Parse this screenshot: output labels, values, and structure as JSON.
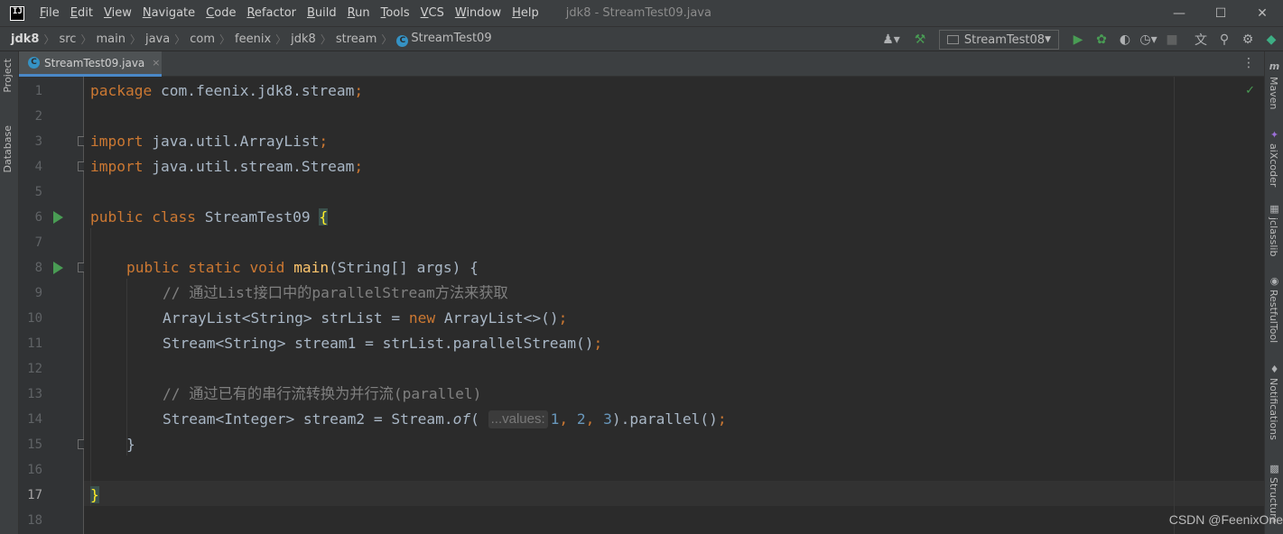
{
  "window": {
    "title": "jdk8 - StreamTest09.java",
    "logo": "IJ",
    "minimize_icon": "—",
    "maximize_icon": "☐",
    "close_icon": "✕"
  },
  "menu": [
    {
      "label": "File"
    },
    {
      "label": "Edit"
    },
    {
      "label": "View"
    },
    {
      "label": "Navigate"
    },
    {
      "label": "Code"
    },
    {
      "label": "Refactor"
    },
    {
      "label": "Build"
    },
    {
      "label": "Run"
    },
    {
      "label": "Tools"
    },
    {
      "label": "VCS"
    },
    {
      "label": "Window"
    },
    {
      "label": "Help"
    }
  ],
  "breadcrumb": [
    "jdk8",
    "src",
    "main",
    "java",
    "com",
    "feenix",
    "jdk8",
    "stream",
    "StreamTest09"
  ],
  "toolbar": {
    "run_config": "StreamTest08",
    "icons": [
      "user-icon",
      "build-hammer-icon",
      "run-icon",
      "debug-icon",
      "coverage-icon",
      "profile-icon",
      "stop-icon",
      "translate-icon",
      "search-icon",
      "settings-icon",
      "toolbox-icon"
    ]
  },
  "left_tools": {
    "project": "Project",
    "database": "Database"
  },
  "right_tools": {
    "maven": "Maven",
    "aixcoder": "aiXcoder",
    "jclasslib": "jclasslib",
    "restfultool": "RestfulTool",
    "notifications": "Notifications",
    "structure": "Structure"
  },
  "editor_tab": {
    "name": "StreamTest09.java",
    "close": "×"
  },
  "editor": {
    "line_numbers": [
      "1",
      "2",
      "3",
      "4",
      "5",
      "6",
      "7",
      "8",
      "9",
      "10",
      "11",
      "12",
      "13",
      "14",
      "15",
      "16",
      "17",
      "18"
    ],
    "current_line": 17,
    "lines": {
      "l1_kw": "package",
      "l1_rest": " com.feenix.jdk8.stream",
      "l1_semi": ";",
      "l3_kw": "import",
      "l3_rest": " java.util.ArrayList",
      "l3_semi": ";",
      "l4_kw": "import",
      "l4_rest": " java.util.stream.Stream",
      "l4_semi": ";",
      "l6_kw": "public class",
      "l6_rest": " StreamTest09 ",
      "l6_brace": "{",
      "l8_kw": "public static void",
      "l8_fn": "main",
      "l8_rest": "(String[] args) {",
      "l9_cmt": "// 通过List接口中的parallelStream方法来获取",
      "l10_a": "ArrayList<String> strList = ",
      "l10_kw": "new",
      "l10_b": " ArrayList<>()",
      "l10_semi": ";",
      "l11_a": "Stream<String> stream1 = strList.parallelStream()",
      "l11_semi": ";",
      "l13_cmt": "// 通过已有的串行流转换为并行流(parallel)",
      "l14_a": "Stream<Integer> stream2 = Stream.",
      "l14_of": "of",
      "l14_paren": "(",
      "l14_hint": "...values:",
      "l14_n1": "1",
      "l14_c1": ", ",
      "l14_n2": "2",
      "l14_c2": ", ",
      "l14_n3": "3",
      "l14_b": ").parallel()",
      "l14_semi": ";",
      "l15": "}",
      "l17": "}"
    }
  },
  "watermark": "CSDN @FeenixOne"
}
